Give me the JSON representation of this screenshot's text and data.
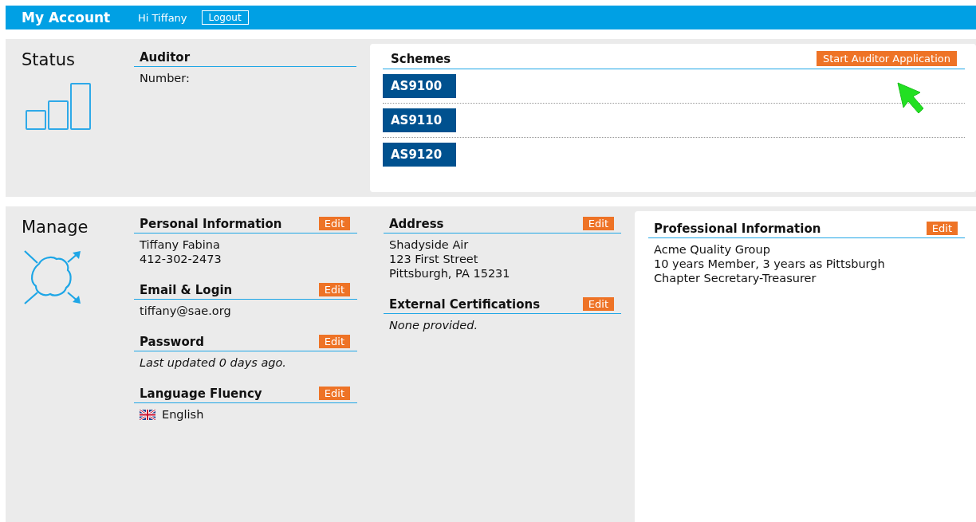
{
  "header": {
    "title": "My Account",
    "greeting": "Hi Tiffany",
    "logout": "Logout"
  },
  "status": {
    "heading": "Status",
    "auditor": {
      "title": "Auditor",
      "kind": "text",
      "lines": [
        "Number:"
      ]
    },
    "schemes": {
      "title": "Schemes",
      "start_button": "Start Auditor Application",
      "items": [
        "AS9100",
        "AS9110",
        "AS9120"
      ]
    }
  },
  "manage": {
    "heading": "Manage",
    "columns": [
      [
        {
          "title": "Personal Information",
          "edit": "Edit",
          "kind": "text",
          "lines": [
            "Tiffany Fabina",
            "412-302-2473"
          ]
        },
        {
          "title": "Email & Login",
          "edit": "Edit",
          "kind": "text",
          "lines": [
            "tiffany@sae.org"
          ]
        },
        {
          "title": "Password",
          "edit": "Edit",
          "kind": "italic",
          "lines": [
            "Last updated 0 days ago."
          ]
        },
        {
          "title": "Language Fluency",
          "edit": "Edit",
          "kind": "language",
          "lines": [
            "English"
          ]
        }
      ],
      [
        {
          "title": "Address",
          "edit": "Edit",
          "kind": "text",
          "lines": [
            "Shadyside Air",
            "123 First Street",
            "Pittsburgh, PA 15231"
          ]
        },
        {
          "title": "External Certifications",
          "edit": "Edit",
          "kind": "italic",
          "lines": [
            "None provided."
          ]
        }
      ],
      [
        {
          "title": "Professional Information",
          "edit": "Edit",
          "kind": "text",
          "lines": [
            "Acme Quality Group",
            "10 years Member, 3 years as Pittsburgh",
            "Chapter Secretary-Treasurer"
          ]
        }
      ]
    ]
  }
}
